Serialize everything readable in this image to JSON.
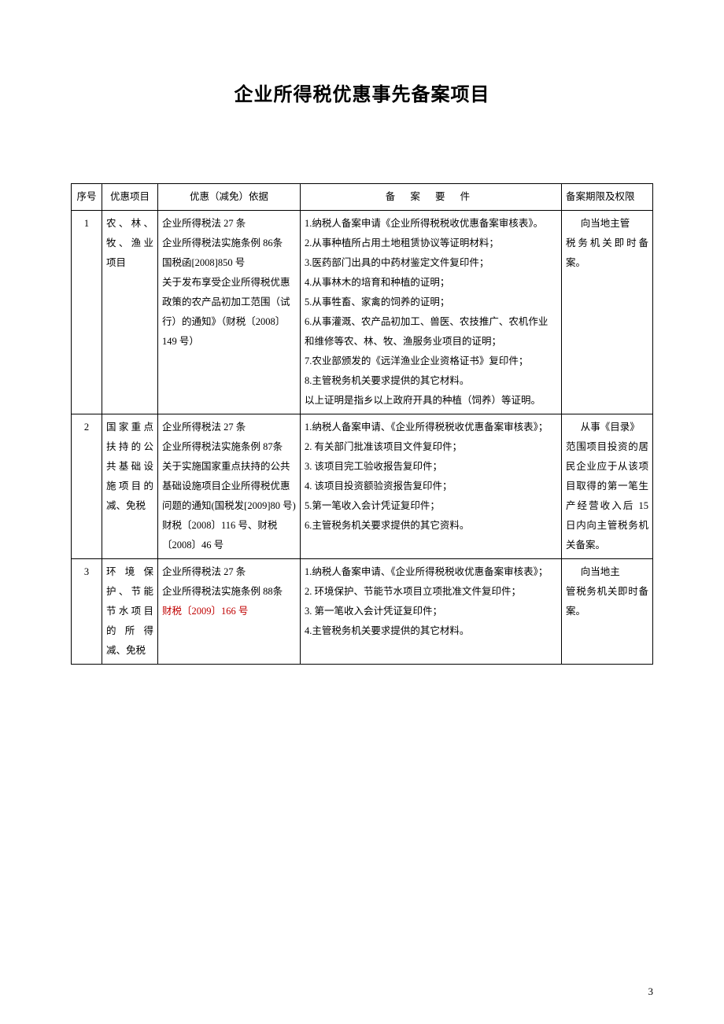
{
  "page": {
    "title": "企业所得税优惠事先备案项目",
    "page_number": "3"
  },
  "table": {
    "headers": {
      "index": "序号",
      "item": "优惠项目",
      "basis": "优惠（减免）依据",
      "requirements": "备 案 要 件",
      "period": "备案期限及权限"
    },
    "rows": [
      {
        "index": "1",
        "item": "农、林、牧、渔业项目",
        "basis": "企业所得税法 27 条\n企业所得税法实施条例 86条\n国税函[2008]850 号\n关于发布享受企业所得税优惠政策的农产品初加工范围（试行）的通知》（财税〔2008〕149 号）",
        "req": "1.纳税人备案申请《企业所得税税收优惠备案审核表》。\n2.从事种植所占用土地租赁协议等证明材料；\n3.医药部门出具的中药材鉴定文件复印件；\n4.从事林木的培育和种植的证明；\n5.从事牲畜、家禽的饲养的证明；\n6.从事灌溉、农产品初加工、兽医、农技推广、农机作业和维修等农、林、牧、渔服务业项目的证明；\n7.农业部颁发的《远洋渔业企业资格证书》复印件；\n8.主管税务机关要求提供的其它材料。\n以上证明是指乡以上政府开具的种植（饲养）等证明。",
        "period_indent": "向当地主管",
        "period_rest": "税务机关即时备案。"
      },
      {
        "index": "2",
        "item": "国家重点扶持的公共基础设施项目的减、免税",
        "basis": "企业所得税法 27 条\n企业所得税法实施条例 87条\n关于实施国家重点扶持的公共基础设施项目企业所得税优惠问题的通知(国税发[2009]80 号)\n财税〔2008〕116 号、财税〔2008〕46 号",
        "req": "1.纳税人备案申请、《企业所得税税收优惠备案审核表》；\n2. 有关部门批准该项目文件复印件；\n3. 该项目完工验收报告复印件；\n4. 该项目投资额验资报告复印件；\n5.第一笔收入会计凭证复印件；\n6.主管税务机关要求提供的其它资料。",
        "period_indent": "从事《目录》",
        "period_rest": "范围项目投资的居民企业应于从该项目取得的第一笔生产经营收入后 15 日内向主管税务机关备案。"
      },
      {
        "index": "3",
        "item": "环境保护、节能节水项目的所得减、免税",
        "basis_plain": "企业所得税法 27 条\n企业所得税法实施条例 88条",
        "basis_red": "财税〔2009〕166 号",
        "req": "1.纳税人备案申请、《企业所得税税收优惠备案审核表》；\n2. 环境保护、节能节水项目立项批准文件复印件；\n3. 第一笔收入会计凭证复印件；\n4.主管税务机关要求提供的其它材料。",
        "period_indent": "向当地主",
        "period_rest": "管税务机关即时备案。"
      }
    ]
  }
}
